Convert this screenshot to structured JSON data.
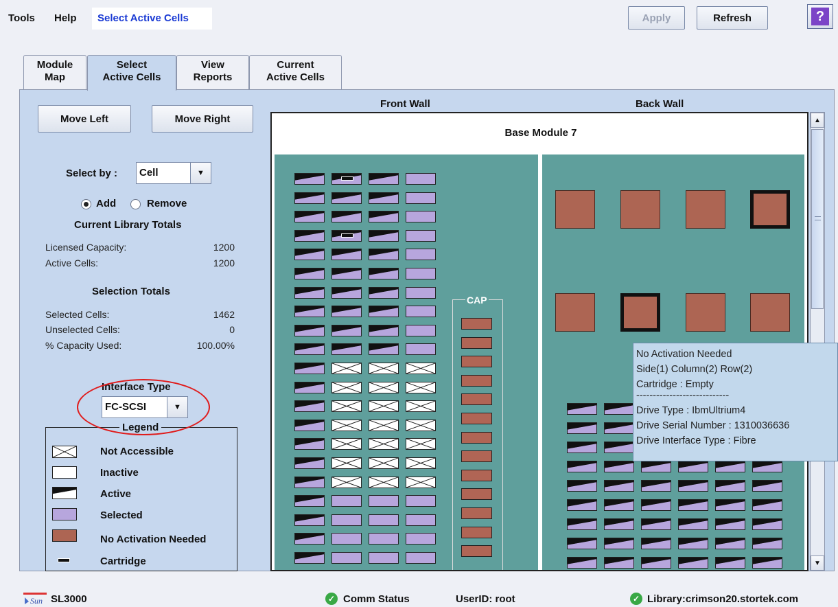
{
  "menu": {
    "tools": "Tools",
    "help": "Help",
    "title": "Select Active Cells"
  },
  "toolbar": {
    "apply": "Apply",
    "refresh": "Refresh",
    "help_icon": "?"
  },
  "tabs": [
    {
      "line1": "Module",
      "line2": "Map"
    },
    {
      "line1": "Select",
      "line2": "Active Cells"
    },
    {
      "line1": "View",
      "line2": "Reports"
    },
    {
      "line1": "Current",
      "line2": "Active Cells"
    }
  ],
  "controls": {
    "move_left": "Move Left",
    "move_right": "Move Right",
    "select_by_label": "Select by :",
    "select_by_value": "Cell",
    "add_label": "Add",
    "remove_label": "Remove",
    "mode": "Add"
  },
  "library_totals": {
    "heading": "Current Library Totals",
    "licensed_label": "Licensed Capacity:",
    "licensed_value": "1200",
    "active_label": "Active Cells:",
    "active_value": "1200"
  },
  "selection_totals": {
    "heading": "Selection Totals",
    "selected_label": "Selected Cells:",
    "selected_value": "1462",
    "unselected_label": "Unselected Cells:",
    "unselected_value": "0",
    "capacity_label": "% Capacity Used:",
    "capacity_value": "100.00%"
  },
  "interface": {
    "label": "Interface Type",
    "value": "FC-SCSI"
  },
  "legend": {
    "title": "Legend",
    "items": [
      "Not Accessible",
      "Inactive",
      "Active",
      "Selected",
      "No Activation Needed",
      "Cartridge"
    ]
  },
  "map": {
    "front_wall": "Front Wall",
    "back_wall": "Back Wall",
    "module_title": "Base Module 7",
    "cap_label": "CAP"
  },
  "tooltip": {
    "lines": [
      "No Activation Needed",
      "Side(1) Column(2) Row(2)",
      "Cartridge : Empty",
      "----------------------------",
      "Drive Type : IbmUltrium4",
      "Drive Serial Number : 1310036636",
      "Drive Interface Type : Fibre"
    ]
  },
  "status": {
    "product": "SL3000",
    "brand": "Sun",
    "comm": "Comm Status",
    "user": "UserID: root",
    "library": "Library:crimson20.stortek.com"
  },
  "colors": {
    "panel": "#c6d7ee",
    "teal": "#5f9f9c",
    "selected": "#b7a6dd",
    "no_activation": "#ad6553",
    "accent_title": "#1a3ad4",
    "ok_green": "#39a845"
  }
}
